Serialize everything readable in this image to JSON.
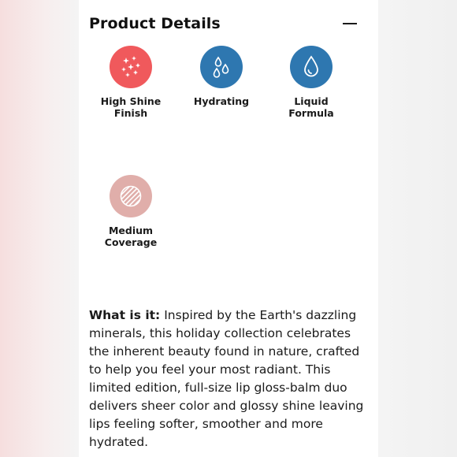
{
  "section": {
    "title": "Product Details"
  },
  "features": [
    {
      "line1": "High Shine",
      "line2": "Finish",
      "icon": "sparkles-icon",
      "color": "#f0595c"
    },
    {
      "line1": "Hydrating",
      "line2": "",
      "icon": "water-drops-icon",
      "color": "#2e77b0"
    },
    {
      "line1": "Liquid",
      "line2": "Formula",
      "icon": "liquid-drop-icon",
      "color": "#2e77b0"
    },
    {
      "line1": "Medium",
      "line2": "Coverage",
      "icon": "coverage-stripes-icon",
      "color": "#e0aeaa"
    }
  ],
  "description": {
    "lead": "What is it:",
    "body": "Inspired by the Earth's dazzling minerals, this holiday collection celebrates the inherent beauty found in nature, crafted to help you feel your most radiant. This limited edition, full-size lip gloss-balm duo delivers sheer color and glossy shine leaving lips feeling softer, smoother and more hydrated."
  }
}
